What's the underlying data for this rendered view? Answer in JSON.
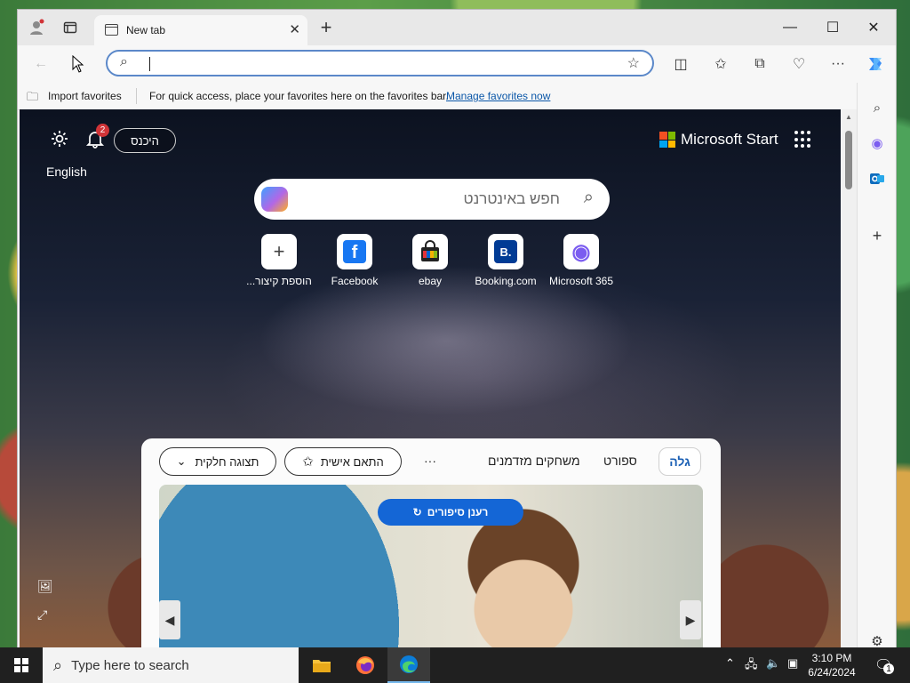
{
  "browser": {
    "tab_title": "New tab",
    "new_tab_symbol": "+",
    "window_controls": {
      "minimize": "—",
      "maximize": "☐",
      "close": "✕"
    },
    "address_placeholder": "",
    "favorites_bar": {
      "import_label": "Import favorites",
      "hint_text": "For quick access, place your favorites here on the favorites bar.",
      "manage_link": "Manage favorites now"
    }
  },
  "newtab": {
    "signin_label": "היכנס",
    "notification_count": "2",
    "language_label": "English",
    "brand_label": "Microsoft Start",
    "search_placeholder": "חפש באינטרנט",
    "quick_links": [
      {
        "label": "הוספת קיצור...",
        "icon_text": "+",
        "icon_color": "#444444"
      },
      {
        "label": "Facebook",
        "icon_text": "f",
        "icon_color": "#1877f2"
      },
      {
        "label": "ebay",
        "icon_text": "🛍",
        "icon_color": "#222222"
      },
      {
        "label": "Booking.com",
        "icon_text": "B.",
        "icon_color": "#003b95"
      },
      {
        "label": "Microsoft 365",
        "icon_text": "◉",
        "icon_color": "#7b5cf0"
      }
    ],
    "feed": {
      "tabs": [
        "גלה",
        "ספורט",
        "משחקים מזדמנים"
      ],
      "more_symbol": "···",
      "personalize_label": "התאם אישית",
      "view_label": "תצוגה חלקית",
      "refresh_label": "רענן סיפורים"
    }
  },
  "taskbar": {
    "search_placeholder": "Type here to search",
    "time": "3:10 PM",
    "date": "6/24/2024",
    "notification_count": "1"
  },
  "colors": {
    "accent": "#1466d6",
    "link": "#0b57a8",
    "badge": "#d13438"
  }
}
